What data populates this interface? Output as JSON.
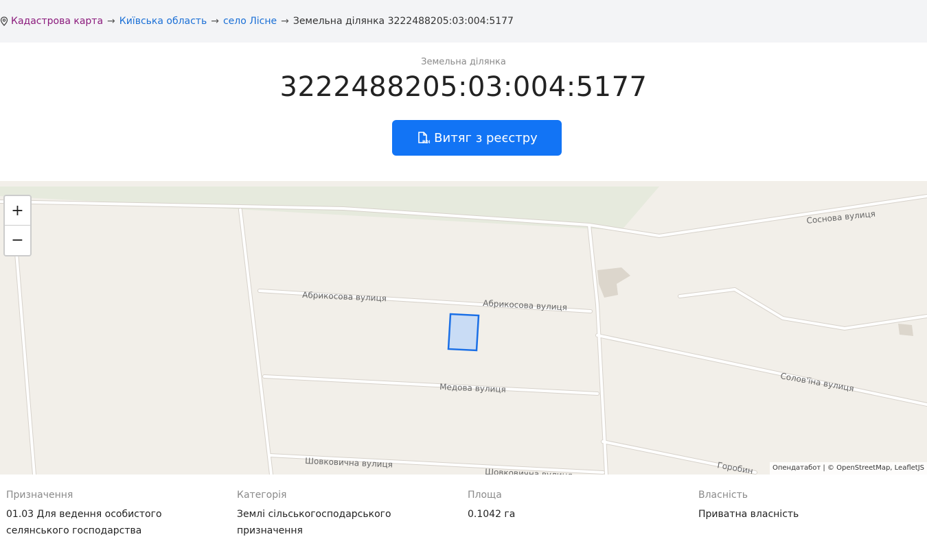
{
  "breadcrumb": {
    "root": "Кадастрова карта",
    "region": "Київська область",
    "village": "село Лісне",
    "current": "Земельна ділянка 3222488205:03:004:5177",
    "separator": "→"
  },
  "header": {
    "subtitle": "Земельна ділянка",
    "title": "3222488205:03:004:5177",
    "extract_button": "Витяг з реєстру"
  },
  "map": {
    "zoom_in": "+",
    "zoom_out": "−",
    "attribution": "Опендатабот | © OpenStreetMap, LeafletJS",
    "streets": {
      "sosnova": "Соснова вулиця",
      "abrykosova": "Абрикосова вулиця",
      "medova": "Медова вулиця",
      "soloviina": "Солов'їна вулиця",
      "shovkovychna": "Шовковична вулиця",
      "horobyn": "Горобин"
    },
    "colors": {
      "land": "#f2efe9",
      "road": "#ffffff",
      "road_edge": "#d7d2cb",
      "parcel_fill": "#c9dcf5",
      "parcel_stroke": "#1a6fe6",
      "green": "#e6eadd"
    }
  },
  "info": [
    {
      "label": "Призначення",
      "value": "01.03 Для ведення особистого селянського господарства"
    },
    {
      "label": "Категорія",
      "value": "Землі сільськогосподарського призначення"
    },
    {
      "label": "Площа",
      "value": "0.1042 га"
    },
    {
      "label": "Власність",
      "value": "Приватна власність"
    }
  ]
}
